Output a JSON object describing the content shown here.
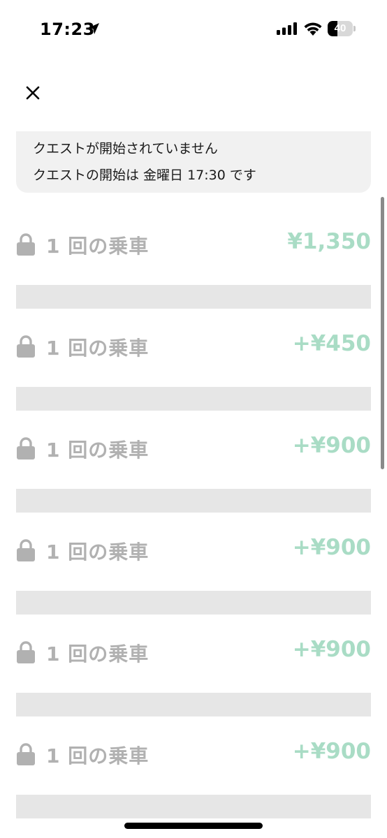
{
  "status_bar": {
    "time": "17:23",
    "battery_percent": "40",
    "battery_level": 0.4,
    "icons": [
      "location-arrow-icon",
      "cellular-signal-icon",
      "wifi-icon",
      "battery-icon"
    ]
  },
  "header": {
    "close_icon": "close-icon"
  },
  "notice": {
    "line1": "クエストが開始されていません",
    "line2": "クエストの開始は 金曜日 17:30 です"
  },
  "quests": [
    {
      "label": "1 回の乗車",
      "amount": "¥1,350",
      "icon": "lock-icon"
    },
    {
      "label": "1 回の乗車",
      "amount": "+¥450",
      "icon": "lock-icon"
    },
    {
      "label": "1 回の乗車",
      "amount": "+¥900",
      "icon": "lock-icon"
    },
    {
      "label": "1 回の乗車",
      "amount": "+¥900",
      "icon": "lock-icon"
    },
    {
      "label": "1 回の乗車",
      "amount": "+¥900",
      "icon": "lock-icon"
    },
    {
      "label": "1 回の乗車",
      "amount": "+¥900",
      "icon": "lock-icon"
    }
  ],
  "colors": {
    "accent_green": "#a9dcc5",
    "locked_gray": "#b1b1b1",
    "placeholder_bar": "#e6e6e6",
    "notice_bg": "#f1f1f1"
  }
}
